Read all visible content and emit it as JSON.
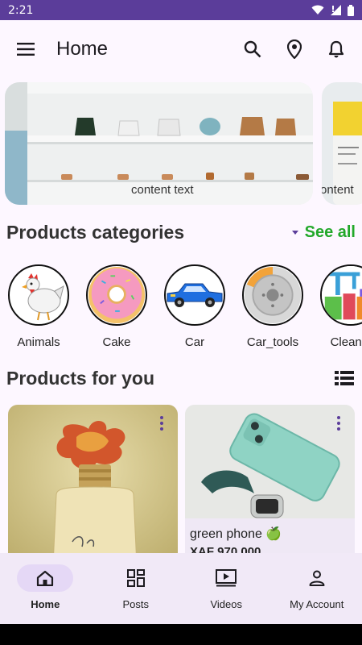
{
  "status_bar": {
    "time": "2:21"
  },
  "app_bar": {
    "title": "Home",
    "icons": [
      "menu-icon",
      "search-icon",
      "location-icon",
      "bell-icon"
    ]
  },
  "carousel": {
    "slides": [
      {
        "caption": "content text"
      },
      {
        "caption": "ontent"
      }
    ]
  },
  "categories_section": {
    "title": "Products categories",
    "see_all": "See all",
    "items": [
      {
        "label": "Animals"
      },
      {
        "label": "Cake"
      },
      {
        "label": "Car"
      },
      {
        "label": "Car_tools"
      },
      {
        "label": "Cleanin"
      }
    ]
  },
  "products_section": {
    "title": "Products for you",
    "items": [
      {
        "title": "",
        "price": ""
      },
      {
        "title": "green phone 🍏",
        "price": "XAF 970,000"
      }
    ]
  },
  "bottom_nav": {
    "items": [
      {
        "label": "Home",
        "icon": "home-icon",
        "active": true
      },
      {
        "label": "Posts",
        "icon": "grid-icon",
        "active": false
      },
      {
        "label": "Videos",
        "icon": "video-icon",
        "active": false
      },
      {
        "label": "My Account",
        "icon": "account-icon",
        "active": false
      }
    ]
  },
  "colors": {
    "status_bar": "#5b3d9a",
    "accent": "#5b3d9a",
    "see_all": "#22a82a",
    "nav_bg": "#f1e9f7"
  }
}
